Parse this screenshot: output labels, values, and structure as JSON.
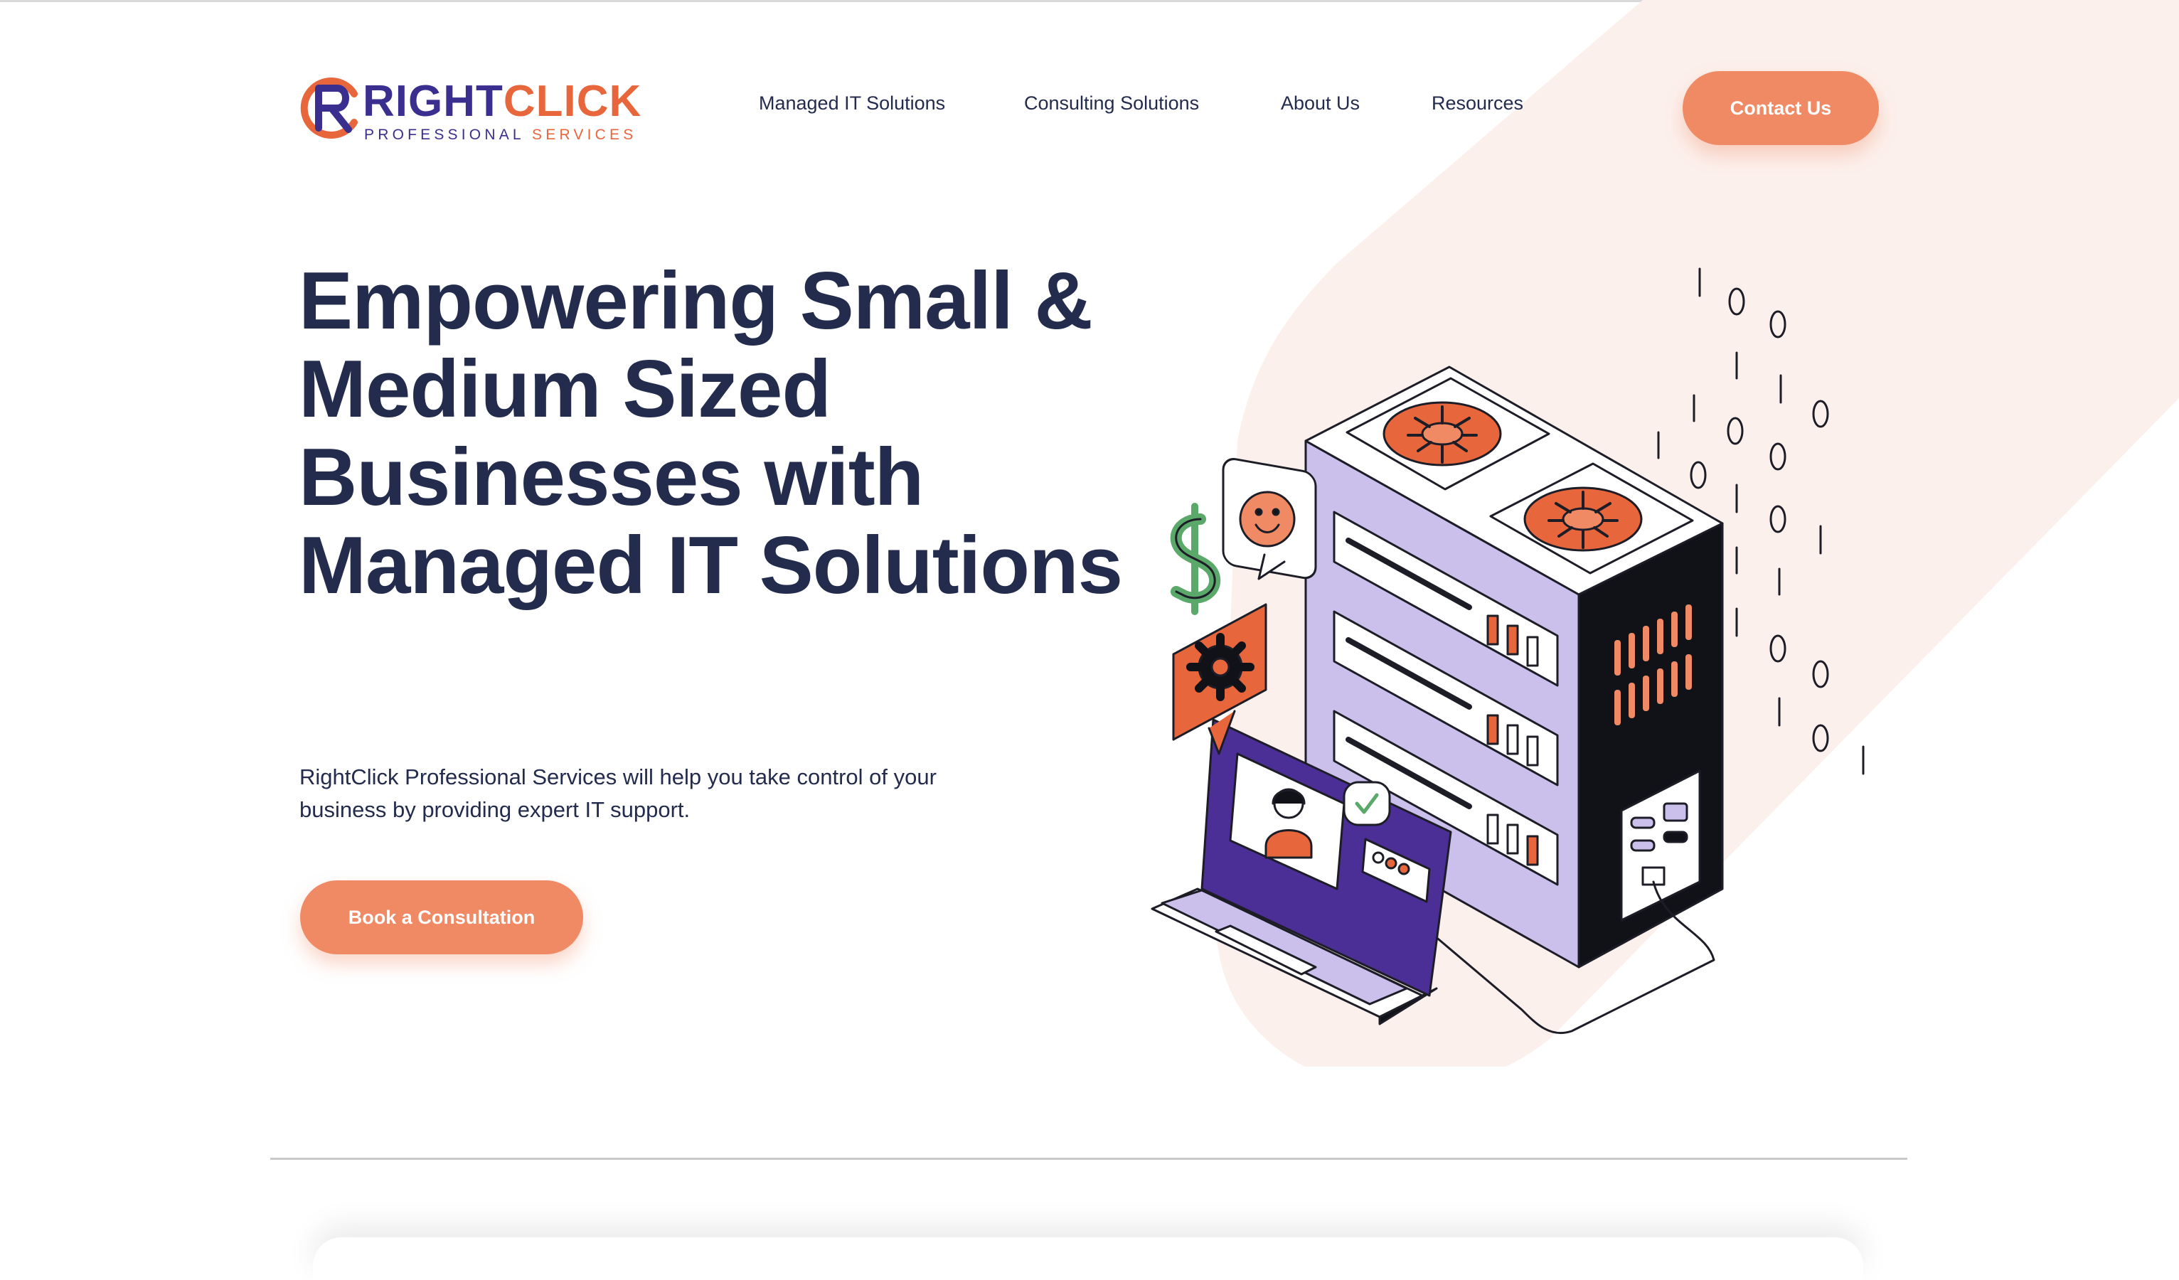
{
  "brand": {
    "word_part1": "RIGHT",
    "word_part2": "CLICK",
    "sub_part1": "PROFESSIONAL ",
    "sub_part2": "SERVICES",
    "primary_color": "#3a2f8f",
    "accent_color": "#e8663c"
  },
  "nav": {
    "items": [
      {
        "label": "Managed IT Solutions"
      },
      {
        "label": "Consulting Solutions"
      },
      {
        "label": "About Us"
      },
      {
        "label": "Resources"
      }
    ],
    "cta_label": "Contact Us"
  },
  "hero": {
    "title": "Empowering Small & Medium Sized Businesses with Managed IT Solutions",
    "subtitle": "RightClick Professional Services will help you take control of your business by providing expert IT support.",
    "cta_label": "Book a Consultation"
  },
  "colors": {
    "button": "#f08a65",
    "heading": "#232c4d",
    "band": "#fcf0ec",
    "server_side": "#cbc0ec",
    "laptop_screen": "#4b2f97"
  },
  "icons": [
    "logo-mark-icon",
    "fan-icon",
    "smiley-chat-icon",
    "dollar-icon",
    "gear-chat-icon",
    "checkmark-icon",
    "user-avatar-icon"
  ]
}
